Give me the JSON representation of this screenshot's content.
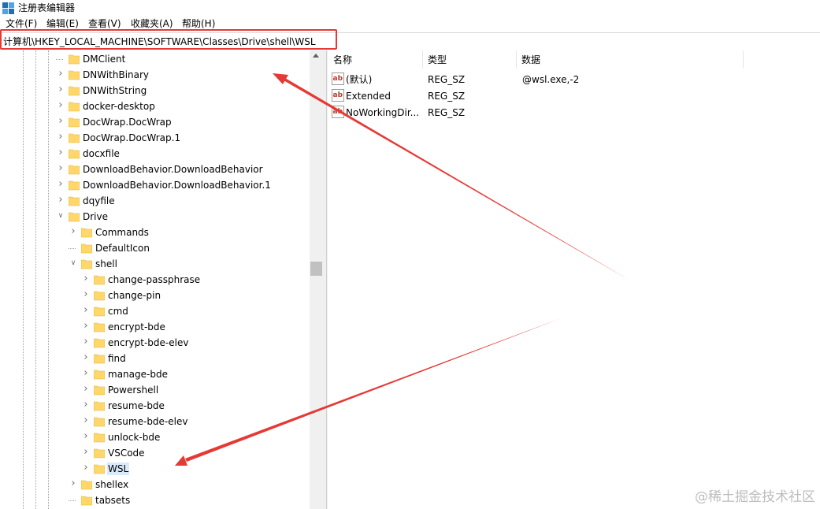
{
  "window": {
    "title": "注册表编辑器"
  },
  "menu": {
    "items": [
      "文件(F)",
      "编辑(E)",
      "查看(V)",
      "收藏夹(A)",
      "帮助(H)"
    ]
  },
  "address": {
    "path": "计算机\\HKEY_LOCAL_MACHINE\\SOFTWARE\\Classes\\Drive\\shell\\WSL"
  },
  "tree": {
    "items": [
      {
        "label": "DMClient",
        "expander": "none",
        "level": 0
      },
      {
        "label": "DNWithBinary",
        "expander": "collapsed",
        "level": 0
      },
      {
        "label": "DNWithString",
        "expander": "collapsed",
        "level": 0
      },
      {
        "label": "docker-desktop",
        "expander": "collapsed",
        "level": 0
      },
      {
        "label": "DocWrap.DocWrap",
        "expander": "collapsed",
        "level": 0
      },
      {
        "label": "DocWrap.DocWrap.1",
        "expander": "collapsed",
        "level": 0
      },
      {
        "label": "docxfile",
        "expander": "collapsed",
        "level": 0
      },
      {
        "label": "DownloadBehavior.DownloadBehavior",
        "expander": "collapsed",
        "level": 0
      },
      {
        "label": "DownloadBehavior.DownloadBehavior.1",
        "expander": "collapsed",
        "level": 0
      },
      {
        "label": "dqyfile",
        "expander": "collapsed",
        "level": 0
      },
      {
        "label": "Drive",
        "expander": "expanded",
        "level": 0
      },
      {
        "label": "Commands",
        "expander": "collapsed",
        "level": 1
      },
      {
        "label": "DefaultIcon",
        "expander": "none",
        "level": 1
      },
      {
        "label": "shell",
        "expander": "expanded",
        "level": 1
      },
      {
        "label": "change-passphrase",
        "expander": "collapsed",
        "level": 2
      },
      {
        "label": "change-pin",
        "expander": "collapsed",
        "level": 2
      },
      {
        "label": "cmd",
        "expander": "collapsed",
        "level": 2
      },
      {
        "label": "encrypt-bde",
        "expander": "collapsed",
        "level": 2
      },
      {
        "label": "encrypt-bde-elev",
        "expander": "collapsed",
        "level": 2
      },
      {
        "label": "find",
        "expander": "collapsed",
        "level": 2
      },
      {
        "label": "manage-bde",
        "expander": "collapsed",
        "level": 2
      },
      {
        "label": "Powershell",
        "expander": "collapsed",
        "level": 2
      },
      {
        "label": "resume-bde",
        "expander": "collapsed",
        "level": 2
      },
      {
        "label": "resume-bde-elev",
        "expander": "collapsed",
        "level": 2
      },
      {
        "label": "unlock-bde",
        "expander": "collapsed",
        "level": 2
      },
      {
        "label": "VSCode",
        "expander": "collapsed",
        "level": 2
      },
      {
        "label": "WSL",
        "expander": "collapsed",
        "level": 2,
        "selected": true
      },
      {
        "label": "shellex",
        "expander": "collapsed",
        "level": 1
      },
      {
        "label": "tabsets",
        "expander": "none",
        "level": 1
      }
    ]
  },
  "list": {
    "columns": [
      "名称",
      "类型",
      "数据"
    ],
    "rows": [
      {
        "icon": "string-value-icon",
        "name": "(默认)",
        "type": "REG_SZ",
        "data": "@wsl.exe,-2"
      },
      {
        "icon": "string-value-icon",
        "name": "Extended",
        "type": "REG_SZ",
        "data": ""
      },
      {
        "icon": "string-value-icon",
        "name": "NoWorkingDir...",
        "type": "REG_SZ",
        "data": ""
      }
    ]
  },
  "watermark": "@稀土掘金技术社区",
  "colors": {
    "annotation": "#e53935",
    "folder": "#ffd76b",
    "selection": "#d9ebf9"
  }
}
